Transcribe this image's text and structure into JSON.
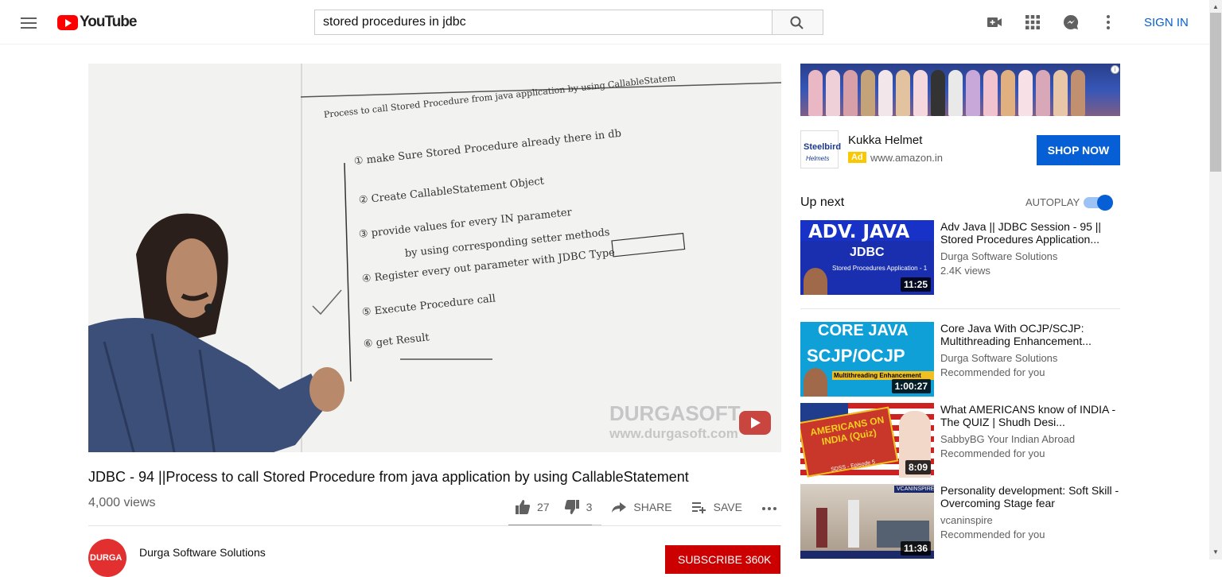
{
  "header": {
    "logo_text": "YouTube",
    "search_value": "stored procedures in jdbc",
    "sign_in": "SIGN IN"
  },
  "player": {
    "board_title": "Process to call Stored Procedure from java application by using CallableStatem",
    "board_lines": [
      "① make Sure Stored Procedure already there in db",
      "② Create CallableStatement Object",
      "③ provide values for every IN parameter",
      "by using corresponding setter methods",
      "④ Register every out parameter with JDBC Type",
      "⑤ Execute Procedure call",
      "⑥ get Result"
    ],
    "watermark": "DURGASOFT",
    "watermark_url": "www.durgasoft.com"
  },
  "video": {
    "title": "JDBC - 94 ||Process to call Stored Procedure from java application by using CallableStatement",
    "views": "4,000 views",
    "likes": "27",
    "dislikes": "3",
    "share": "SHARE",
    "save": "SAVE",
    "sentiment_fraction": 0.9
  },
  "channel": {
    "name": "Durga Software Solutions",
    "avatar_text": "DURGA",
    "subscribe": "SUBSCRIBE 360K"
  },
  "ad": {
    "title": "Kukka Helmet",
    "tag": "Ad",
    "url": "www.amazon.in",
    "cta": "SHOP NOW",
    "logo_line1": "Steelbird",
    "logo_line2": "Helmets"
  },
  "sidebar": {
    "up_next": "Up next",
    "autoplay": "AUTOPLAY",
    "autoplay_on": true,
    "videos": [
      {
        "title": "Adv Java || JDBC Session - 95 || Stored Procedures Application...",
        "channel": "Durga Software Solutions",
        "meta": "2.4K views",
        "duration": "11:25",
        "thumb_text": "ADV. JAVA",
        "thumb_sub": "JDBC",
        "thumb_caption": "Stored Procedures Application - 1"
      },
      {
        "title": "Core Java With OCJP/SCJP: Multithreading Enhancement...",
        "channel": "Durga Software Solutions",
        "meta": "Recommended for you",
        "duration": "1:00:27",
        "thumb_text": "CORE JAVA",
        "thumb_sub": "SCJP/OCJP",
        "thumb_caption": "Multithreading Enhancement"
      },
      {
        "title": "What AMERICANS know of INDIA - The QUIZ | Shudh Desi...",
        "channel": "SabbyBG Your Indian Abroad",
        "meta": "Recommended for you",
        "duration": "8:09",
        "thumb_text": "AMERICANS ON INDIA (Quiz)",
        "thumb_caption": "SDSS - Episode 5"
      },
      {
        "title": "Personality development: Soft Skill -Overcoming Stage fear",
        "channel": "vcaninspire",
        "meta": "Recommended for you",
        "duration": "11:36",
        "thumb_text": "VCANINSPIRE"
      }
    ]
  },
  "colors": {
    "brand_red": "#ff0000",
    "link_blue": "#065fd4",
    "subscribe_red": "#cc0000"
  }
}
